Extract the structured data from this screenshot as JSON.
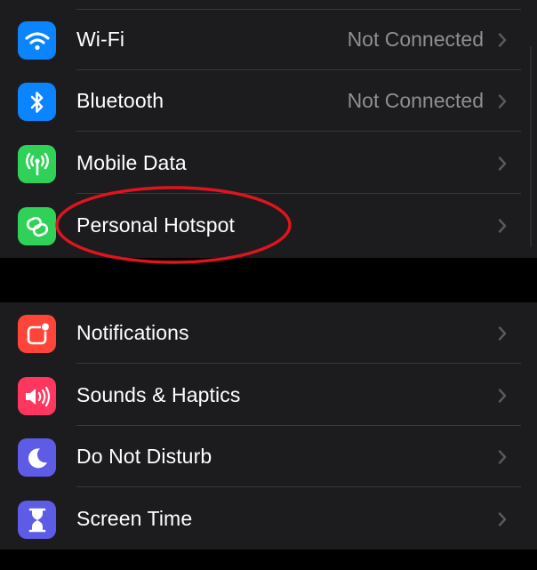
{
  "settings": {
    "connectivity": [
      {
        "label": "Wi-Fi",
        "value": "Not Connected",
        "icon": "wifi-icon",
        "color": "#0a84ff"
      },
      {
        "label": "Bluetooth",
        "value": "Not Connected",
        "icon": "bluetooth-icon",
        "color": "#0a84ff"
      },
      {
        "label": "Mobile Data",
        "value": "",
        "icon": "antenna-icon",
        "color": "#30d158"
      },
      {
        "label": "Personal Hotspot",
        "value": "",
        "icon": "hotspot-icon",
        "color": "#30d158"
      }
    ],
    "general": [
      {
        "label": "Notifications",
        "icon": "notifications-icon",
        "color": "#ff453a"
      },
      {
        "label": "Sounds & Haptics",
        "icon": "speaker-icon",
        "color": "#ff375f"
      },
      {
        "label": "Do Not Disturb",
        "icon": "moon-icon",
        "color": "#5e5ce6"
      },
      {
        "label": "Screen Time",
        "icon": "hourglass-icon",
        "color": "#5e5ce6"
      }
    ]
  },
  "annotation": {
    "color": "#e0141e",
    "target": "Personal Hotspot"
  }
}
